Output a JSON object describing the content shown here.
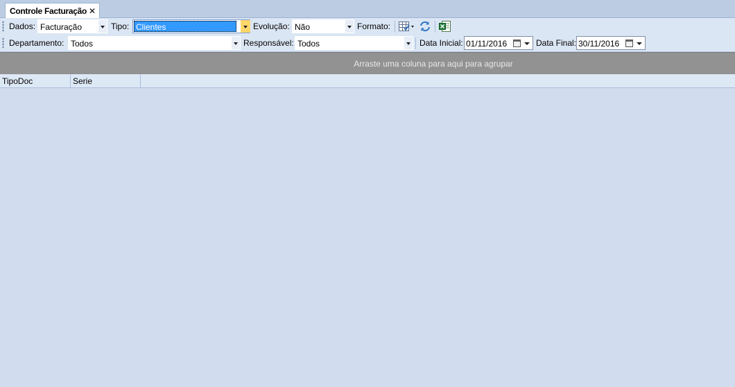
{
  "tab": {
    "title": "Controle Facturação",
    "close": "✕"
  },
  "toolbar1": {
    "dados_label": "Dados:",
    "dados_value": "Facturação",
    "tipo_label": "Tipo:",
    "tipo_value": "Clientes",
    "evolucao_label": "Evolução:",
    "evolucao_value": "Não",
    "formato_label": "Formato:"
  },
  "toolbar2": {
    "departamento_label": "Departamento:",
    "departamento_value": "Todos",
    "responsavel_label": "Responsável:",
    "responsavel_value": "Todos",
    "data_inicial_label": "Data Inicial:",
    "data_inicial_value": "01/11/2016",
    "data_final_label": "Data Final:",
    "data_final_value": "30/11/2016"
  },
  "group_panel": {
    "hint": "Arraste uma coluna para aqui para agrupar"
  },
  "grid": {
    "columns": [
      "TipoDoc",
      "Serie"
    ]
  },
  "colors": {
    "tabstrip": "#bccde3",
    "toolbar": "#dbe6f4",
    "group_panel": "#929292",
    "grid_bg": "#d1ddee",
    "selection": "#3399ff",
    "active_arrow": "#ffd66b"
  }
}
